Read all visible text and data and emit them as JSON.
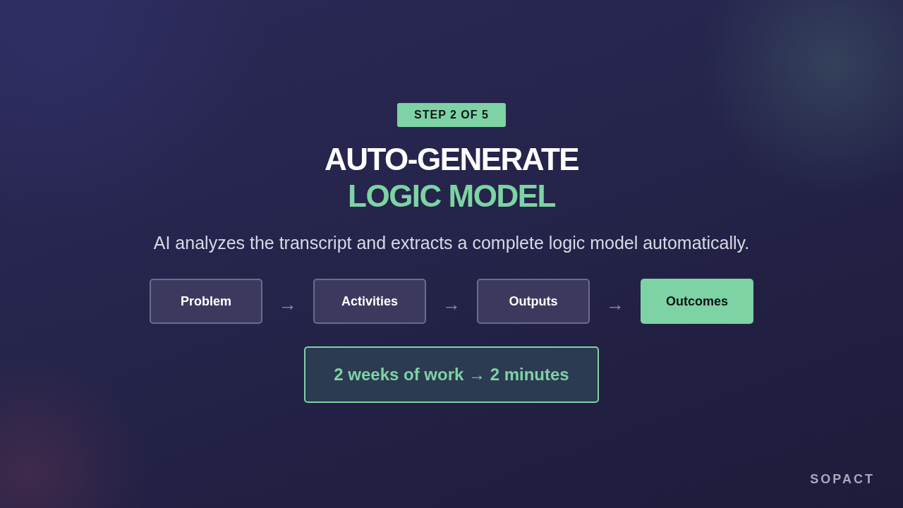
{
  "badge": "STEP 2 OF 5",
  "title": {
    "line_1": "AUTO-GENERATE",
    "line_2": "LOGIC MODEL"
  },
  "subtitle": "AI analyzes the transcript and extracts a complete logic model automatically.",
  "flow": [
    {
      "label": "Problem",
      "highlighted": false,
      "arrow": "→"
    },
    {
      "label": "Activities",
      "highlighted": false,
      "arrow": "→"
    },
    {
      "label": "Outputs",
      "highlighted": false,
      "arrow": "→"
    },
    {
      "label": "Outcomes",
      "highlighted": true
    }
  ],
  "callout": "2 weeks of work → 2 minutes",
  "brand": "SOPACT"
}
